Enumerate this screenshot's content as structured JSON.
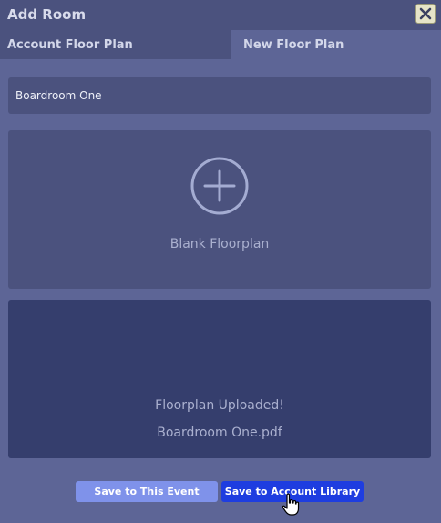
{
  "dialog": {
    "title": "Add Room",
    "close_icon": "close-x-icon"
  },
  "tabs": [
    {
      "label": "Account Floor Plan",
      "active": false
    },
    {
      "label": "New Floor Plan",
      "active": true
    }
  ],
  "room_name": {
    "value": "Boardroom One"
  },
  "blank_floorplan": {
    "icon": "plus-circle-icon",
    "label": "Blank Floorplan"
  },
  "upload": {
    "status": "Floorplan Uploaded!",
    "filename": "Boardroom One.pdf"
  },
  "buttons": {
    "save_event": "Save to This Event",
    "save_library": "Save to Account Library"
  },
  "colors": {
    "background": "#5d6596",
    "panel": "#4b527e",
    "upload_panel": "#353e6d",
    "primary_button": "#1e3de0",
    "secondary_button": "#7f92ea"
  }
}
